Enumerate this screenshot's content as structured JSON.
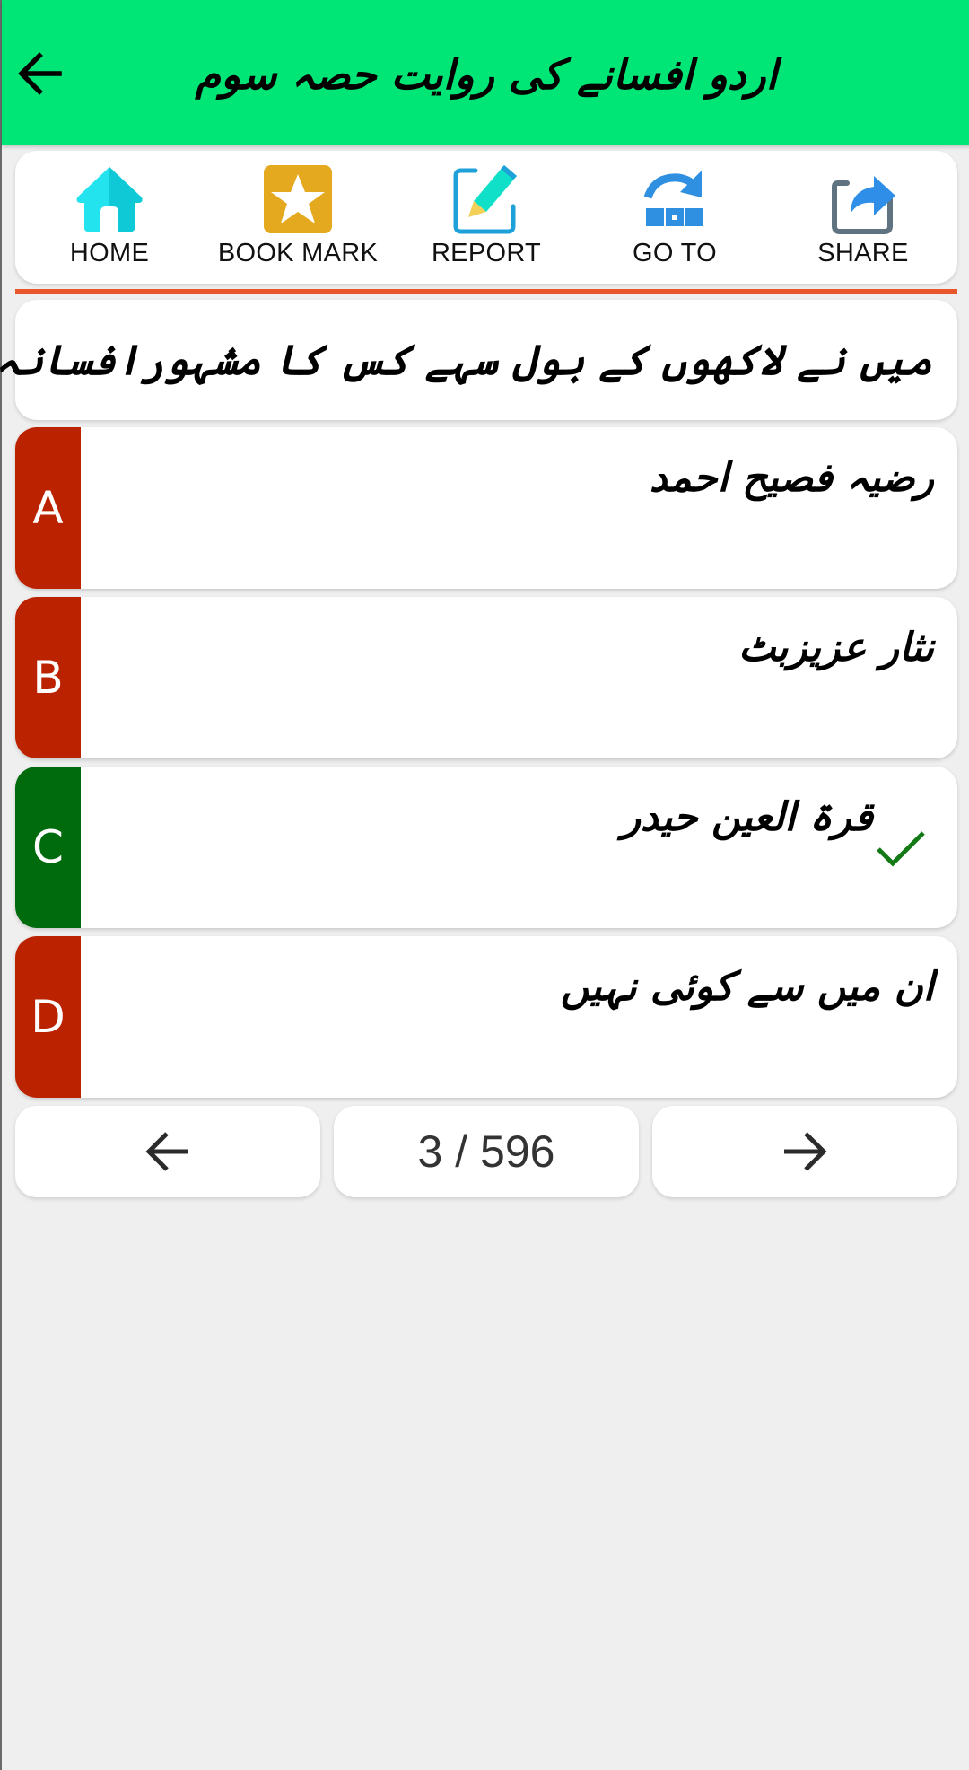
{
  "app_bar": {
    "title": "اردو افسانے کی روایت حصہ سوم",
    "back_icon": "arrow-left-icon",
    "background": "#00e676"
  },
  "toolbar": {
    "items": [
      {
        "label": "HOME",
        "icon": "home-icon"
      },
      {
        "label": "BOOK MARK",
        "icon": "bookmark-star-icon"
      },
      {
        "label": "REPORT",
        "icon": "edit-report-icon"
      },
      {
        "label": "GO TO",
        "icon": "goto-redo-icon"
      },
      {
        "label": "SHARE",
        "icon": "share-icon"
      }
    ]
  },
  "divider_color": "#e8572a",
  "question": {
    "text": "میں نے لاکھوں کے بول سہے کس کا مشہورافسانہ ہے"
  },
  "options": [
    {
      "letter": "A",
      "text": "رضیہ فصیح احمد",
      "status": "incorrect",
      "color": "#bb2200"
    },
    {
      "letter": "B",
      "text": "نثار عزیزبٹ",
      "status": "incorrect",
      "color": "#bb2200"
    },
    {
      "letter": "C",
      "text": "قرۃ العین حیدر",
      "status": "correct",
      "color": "#006b0c",
      "marker_icon": "checkmark-icon"
    },
    {
      "letter": "D",
      "text": "ان میں سے کوئی نہیں",
      "status": "incorrect",
      "color": "#bb2200"
    }
  ],
  "navigation": {
    "prev_icon": "arrow-left-icon",
    "next_icon": "arrow-right-icon",
    "current": 3,
    "total": 596,
    "counter_text": "3 / 596"
  }
}
